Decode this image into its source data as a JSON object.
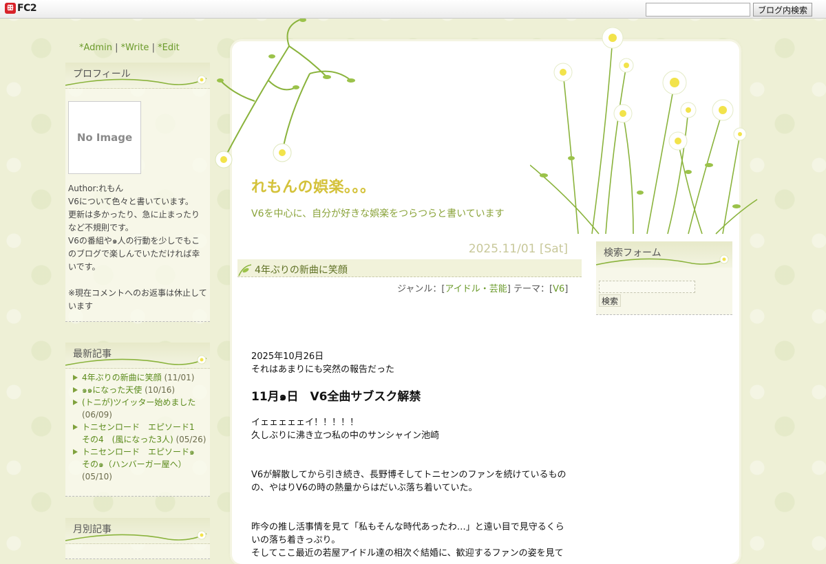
{
  "fc2_bar": {
    "logo_mark": "ꕥ",
    "logo_text": "FC2",
    "search_placeholder": "",
    "search_button": "ブログ内検索"
  },
  "admin_links": {
    "admin": "*Admin",
    "write": "*Write",
    "edit": "*Edit",
    "sep": "|"
  },
  "profile": {
    "heading": "プロフィール",
    "image_alt": "No Image",
    "author": "Author:れもん",
    "lines": [
      "V6について色々と書いています。",
      "更新は多かったり、急に止まったりなど不規則です。",
      "V6の番組や๑人の行動を少しでもこのブログで楽しんでいただければ幸いです。",
      "",
      "※現在コメントへのお返事は休止しています"
    ]
  },
  "recent": {
    "heading": "最新記事",
    "items": [
      {
        "title": "4年ぶりの新曲に笑顔",
        "date": "(11/01)"
      },
      {
        "title": "๑๑になった天使",
        "date": "(10/16)"
      },
      {
        "title": "(トニが)ツイッター始めました",
        "date": "(06/09)"
      },
      {
        "title": "トニセンロード　エピソード1　　その4　(風になった3人)",
        "date": "(05/26)"
      },
      {
        "title": "トニセンロード　エピソード๑　その๑（ハンバーガー屋へ）",
        "date": "(05/10)"
      }
    ]
  },
  "monthly": {
    "heading": "月別記事"
  },
  "blog": {
    "title": "れもんの娯楽。。。",
    "description": "V6を中心に、自分が好きな娯楽をつらつらと書いています"
  },
  "post": {
    "date": "2025.11/01 [Sat]",
    "title": "4年ぶりの新曲に笑顔",
    "genre_label": "ジャンル：[",
    "genre": "アイドル・芸能",
    "theme_label": "] テーマ：[",
    "theme": "V6",
    "theme_close": "]",
    "body": {
      "p1": "2025年10月26日",
      "p2": "それはあまりにも突然の報告だった",
      "heading": "11月๑日　V6全曲サブスク解禁",
      "p3": "イェェェェェイ！！！！！",
      "p4": "久しぶりに沸き立つ私の中のサンシャイン池崎",
      "p5": "V6が解散してから引き続き、長野博そしてトニセンのファンを続けているものの、やはりV6の時の熱量からはだいぶ落ち着いていた。",
      "p6": "昨今の推し活事情を見て「私もそんな時代あったわ…」と遠い目で見守るくらいの落ち着きっぷり。",
      "p7": "そしてここ最近の若屋アイドル達の相次ぐ結婚に、歓迎するファンの姿を見て"
    }
  },
  "search_form": {
    "heading": "検索フォーム",
    "button": "検索"
  },
  "colors": {
    "accent": "#6a9a2a",
    "title": "#d4c23a",
    "desc": "#8aa33a"
  }
}
